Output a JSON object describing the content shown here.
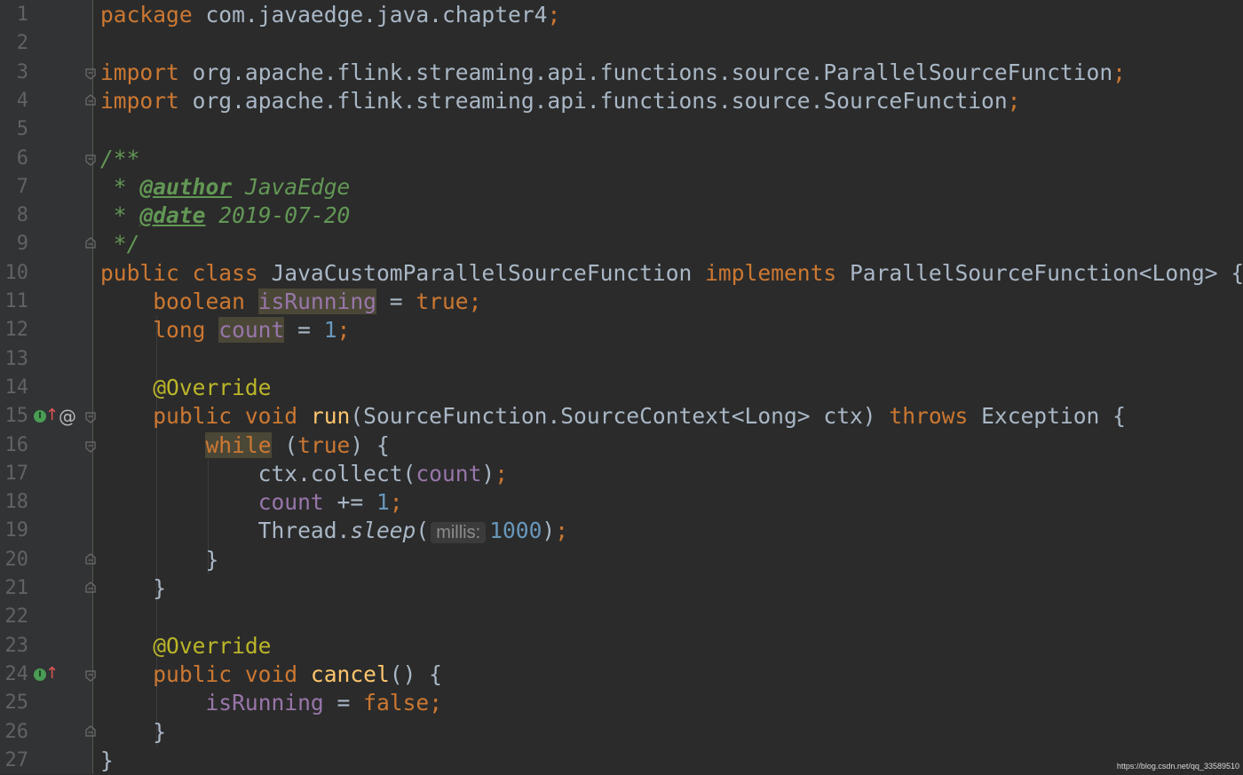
{
  "editor": {
    "line_numbers": [
      "1",
      "2",
      "3",
      "4",
      "5",
      "6",
      "7",
      "8",
      "9",
      "10",
      "11",
      "12",
      "13",
      "14",
      "15",
      "16",
      "17",
      "18",
      "19",
      "20",
      "21",
      "22",
      "23",
      "24",
      "25",
      "26",
      "27"
    ],
    "lines": [
      [
        {
          "t": "package ",
          "c": "kw"
        },
        {
          "t": "com.javaedge.java.chapter4",
          "c": "plain"
        },
        {
          "t": ";",
          "c": "kw"
        }
      ],
      [],
      [
        {
          "t": "import ",
          "c": "kw"
        },
        {
          "t": "org.apache.flink.streaming.api.functions.source.ParallelSourceFunction",
          "c": "plain"
        },
        {
          "t": ";",
          "c": "kw"
        }
      ],
      [
        {
          "t": "import ",
          "c": "kw"
        },
        {
          "t": "org.apache.flink.streaming.api.functions.source.SourceFunction",
          "c": "plain"
        },
        {
          "t": ";",
          "c": "kw"
        }
      ],
      [],
      [
        {
          "t": "/**",
          "c": "doc"
        }
      ],
      [
        {
          "t": " * ",
          "c": "doc"
        },
        {
          "t": "@author",
          "c": "doctag"
        },
        {
          "t": " JavaEdge",
          "c": "doc"
        }
      ],
      [
        {
          "t": " * ",
          "c": "doc"
        },
        {
          "t": "@date",
          "c": "doctag"
        },
        {
          "t": " 2019-07-20",
          "c": "doc"
        }
      ],
      [
        {
          "t": " */",
          "c": "doc"
        }
      ],
      [
        {
          "t": "public class ",
          "c": "kw"
        },
        {
          "t": "JavaCustomParallelSourceFunction ",
          "c": "plain"
        },
        {
          "t": "implements ",
          "c": "kw"
        },
        {
          "t": "ParallelSourceFunction<Long> {",
          "c": "plain"
        }
      ],
      [
        {
          "t": "    boolean ",
          "c": "kw"
        },
        {
          "t": "isRunning",
          "c": "field hl"
        },
        {
          "t": " = ",
          "c": "plain"
        },
        {
          "t": "true;",
          "c": "kw"
        }
      ],
      [
        {
          "t": "    long ",
          "c": "kw"
        },
        {
          "t": "count",
          "c": "field hl"
        },
        {
          "t": " = ",
          "c": "plain"
        },
        {
          "t": "1",
          "c": "num"
        },
        {
          "t": ";",
          "c": "kw"
        }
      ],
      [],
      [
        {
          "t": "    @Override",
          "c": "ann"
        }
      ],
      [
        {
          "t": "    public void ",
          "c": "kw"
        },
        {
          "t": "run",
          "c": "fn"
        },
        {
          "t": "(SourceFunction.SourceContext<Long> ctx) ",
          "c": "plain"
        },
        {
          "t": "throws ",
          "c": "kw"
        },
        {
          "t": "Exception {",
          "c": "plain"
        }
      ],
      [
        {
          "t": "        ",
          "c": "plain"
        },
        {
          "t": "while",
          "c": "kw hl"
        },
        {
          "t": " (",
          "c": "plain"
        },
        {
          "t": "true",
          "c": "kw"
        },
        {
          "t": ") {",
          "c": "plain"
        }
      ],
      [
        {
          "t": "            ctx.collect(",
          "c": "plain"
        },
        {
          "t": "count",
          "c": "field"
        },
        {
          "t": ")",
          "c": "plain"
        },
        {
          "t": ";",
          "c": "kw"
        }
      ],
      [
        {
          "t": "            ",
          "c": "plain"
        },
        {
          "t": "count",
          "c": "field"
        },
        {
          "t": " += ",
          "c": "plain"
        },
        {
          "t": "1",
          "c": "num"
        },
        {
          "t": ";",
          "c": "kw"
        }
      ],
      [
        {
          "t": "            Thread.",
          "c": "plain"
        },
        {
          "t": "sleep",
          "c": "plain ital"
        },
        {
          "t": "(",
          "c": "plain"
        },
        {
          "t": "millis:",
          "c": "hint"
        },
        {
          "t": "1000",
          "c": "num"
        },
        {
          "t": ")",
          "c": "plain"
        },
        {
          "t": ";",
          "c": "kw"
        }
      ],
      [
        {
          "t": "        }",
          "c": "plain"
        }
      ],
      [
        {
          "t": "    }",
          "c": "plain"
        }
      ],
      [],
      [
        {
          "t": "    @Override",
          "c": "ann"
        }
      ],
      [
        {
          "t": "    public void ",
          "c": "kw"
        },
        {
          "t": "cancel",
          "c": "fn"
        },
        {
          "t": "() {",
          "c": "plain"
        }
      ],
      [
        {
          "t": "        ",
          "c": "plain"
        },
        {
          "t": "isRunning",
          "c": "field"
        },
        {
          "t": " = ",
          "c": "plain"
        },
        {
          "t": "false;",
          "c": "kw"
        }
      ],
      [
        {
          "t": "    }",
          "c": "plain"
        }
      ],
      [
        {
          "t": "}",
          "c": "plain"
        }
      ]
    ],
    "fold_markers": [
      {
        "line": 3,
        "dir": "open"
      },
      {
        "line": 4,
        "dir": "close"
      },
      {
        "line": 6,
        "dir": "open"
      },
      {
        "line": 9,
        "dir": "close"
      },
      {
        "line": 15,
        "dir": "open"
      },
      {
        "line": 16,
        "dir": "open"
      },
      {
        "line": 20,
        "dir": "close"
      },
      {
        "line": 21,
        "dir": "close"
      },
      {
        "line": 24,
        "dir": "open"
      },
      {
        "line": 26,
        "dir": "close"
      }
    ],
    "gutter_icons": [
      {
        "line": 15,
        "icons": [
          "implementing-method-icon",
          "override-arrow-icon",
          "at-annotation-icon"
        ]
      },
      {
        "line": 24,
        "icons": [
          "implementing-method-icon",
          "override-arrow-icon"
        ]
      }
    ],
    "colors": {
      "background": "#2b2b2b",
      "gutter": "#313335",
      "keyword": "#cc7832",
      "text": "#a9b7c6",
      "number": "#6897bb",
      "field": "#9876aa",
      "annotation": "#bbb529",
      "method": "#ffc66d",
      "doc": "#629755"
    }
  },
  "watermark": "https://blog.csdn.net/qq_33589510"
}
